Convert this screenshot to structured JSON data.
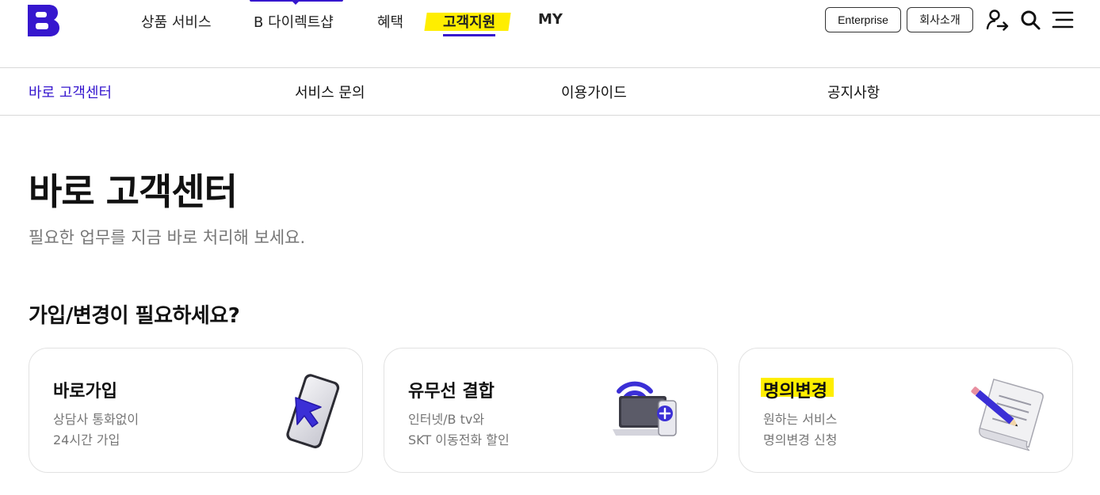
{
  "header": {
    "logo_letter": "B",
    "nav": [
      {
        "label": "상품 서비스"
      },
      {
        "label": "B 다이렉트샵"
      },
      {
        "label": "혜택"
      },
      {
        "label": "고객지원"
      },
      {
        "label": "MY"
      }
    ],
    "active_nav_index": 3,
    "buttons": {
      "enterprise": "Enterprise",
      "company": "회사소개"
    },
    "icons": [
      "user-arrow-icon",
      "search-icon",
      "menu-icon"
    ]
  },
  "sub_nav": {
    "items": [
      {
        "label": "바로 고객센터"
      },
      {
        "label": "서비스 문의"
      },
      {
        "label": "이용가이드"
      },
      {
        "label": "공지사항"
      }
    ],
    "active_index": 0
  },
  "page": {
    "title": "바로 고객센터",
    "description": "필요한 업무를 지금 바로 처리해 보세요.",
    "section_title": "가입/변경이 필요하세요?"
  },
  "cards": [
    {
      "title": "바로가입",
      "line1": "상담사 통화없이",
      "line2": "24시간 가입",
      "illustration": "phone-cursor-icon"
    },
    {
      "title": "유무선 결합",
      "line1": "인터넷/B tv와",
      "line2": "SKT 이동전화 할인",
      "illustration": "laptop-wifi-icon"
    },
    {
      "title": "명의변경",
      "line1": "원하는 서비스",
      "line2": "명의변경 신청",
      "illustration": "document-pencil-icon"
    }
  ],
  "colors": {
    "brand": "#3617ce",
    "highlight": "#ffee00",
    "muted_text": "#767676",
    "border": "#e2e2e2"
  }
}
